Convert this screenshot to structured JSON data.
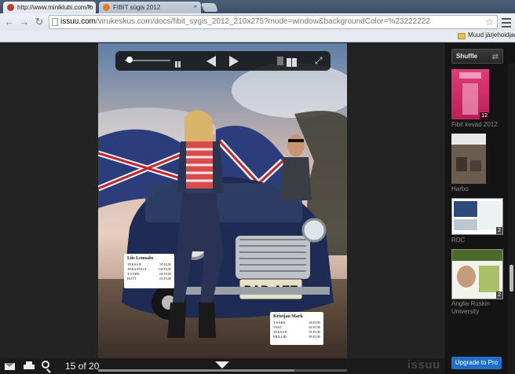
{
  "browser": {
    "tabs": [
      {
        "title": "http://www.miniklubi.com/fo",
        "favicon_color": "#c23a2a",
        "active": true
      },
      {
        "title": "FIBIT sügis 2012",
        "favicon_color": "#e07a24",
        "active": false
      }
    ],
    "close_glyph": "×",
    "address": {
      "host": "issuu.com",
      "rest": "/virukeskus.com/docs/fibit_sygis_2012_210x275?mode=window&backgroundColor=%23222222"
    },
    "nav": {
      "back": "←",
      "forward": "→",
      "reload": "↻"
    },
    "star_glyph": "☆",
    "bookmark_folder": "Muud järjehoidjad"
  },
  "viewer": {
    "page_count": "15 of 20",
    "logo": "issuu",
    "fullscreen_glyph": "⤢",
    "plate": "BAD AZZ",
    "price_cards": [
      {
        "name": "Liis Lemsalu",
        "rows": [
          {
            "label": "TEKSAD",
            "value": "95 EUR"
          },
          {
            "label": "TEKSATAGI",
            "value": "130 EUR"
          },
          {
            "label": "T-SÄRK",
            "value": "60 EUR"
          },
          {
            "label": "BOTT",
            "value": "65 EUR"
          }
        ]
      },
      {
        "name": "Kristjan Mark",
        "rows": [
          {
            "label": "T-SÄRK",
            "value": "40 EUR"
          },
          {
            "label": "VEST",
            "value": "60 EUR"
          },
          {
            "label": "TEKSAD",
            "value": "95 EUR"
          },
          {
            "label": "PRILLID",
            "value": "89 EUR"
          }
        ]
      }
    ]
  },
  "sidebar": {
    "shuffle_label": "Shuffle",
    "shuffle_glyph": "⇄",
    "publications": [
      {
        "title": "Fibit kevad 2012",
        "badge": "12"
      },
      {
        "title": "Harbo",
        "badge": ""
      },
      {
        "title": "RDC",
        "badge": "2"
      },
      {
        "title": "Anglia Ruskin University",
        "badge": "2"
      }
    ],
    "upgrade_label": "Upgrade to Pro"
  },
  "colors": {
    "accent": "#1f6fc8",
    "viewer_bg": "#232323"
  }
}
